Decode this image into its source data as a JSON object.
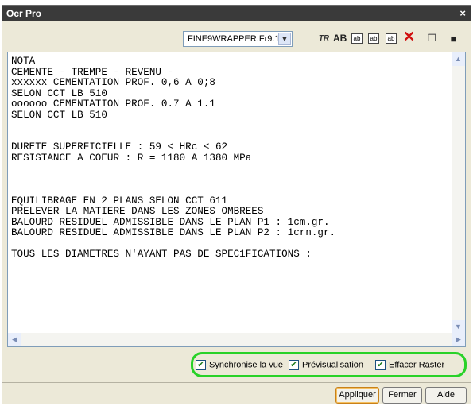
{
  "window": {
    "title": "Ocr Pro",
    "close_glyph": "×"
  },
  "toolbar": {
    "wrapper_select": "FINE9WRAPPER.Fr9.1",
    "icons": {
      "tr": "TR",
      "ab": "AB",
      "i3": "ab",
      "i4": "ab",
      "i5": "ab"
    }
  },
  "text_content": "NOTA\nCEMENTE - TREMPE - REVENU -\nxxxxxx CEMENTATION PROF. 0,6 A 0;8\nSELON CCT LB 510\noooooo CEMENTATION PROF. 0.7 A 1.1\nSELON CCT LB 510\n\n\nDURETE SUPERFICIELLE : 59 < HRc < 62\nRESISTANCE A COEUR : R = 1180 A 1380 MPa\n\n\n\nEQUILIBRAGE EN 2 PLANS SELON CCT 611\nPRELEVER LA MATIERE DANS LES ZONES OMBREES\nBALOURD RESIDUEL ADMISSIBLE DANS LE PLAN P1 : 1cm.gr.\nBALOURD RESIDUEL ADMISSIBLE DANS LE PLAN P2 : 1crn.gr.\n\nTOUS LES DIAMETRES N'AYANT PAS DE SPEC1FICATIONS :",
  "options": {
    "sync_view": {
      "label": "Synchronise la vue",
      "checked": true
    },
    "preview": {
      "label": "Prévisualisation",
      "checked": true
    },
    "erase_raster": {
      "label": "Effacer Raster",
      "checked": true
    }
  },
  "buttons": {
    "apply": "Appliquer",
    "close": "Fermer",
    "help": "Aide"
  },
  "colors": {
    "titlebar": "#3a3a3a",
    "highlight_frame": "#28d228",
    "delete_icon": "#d01010"
  }
}
